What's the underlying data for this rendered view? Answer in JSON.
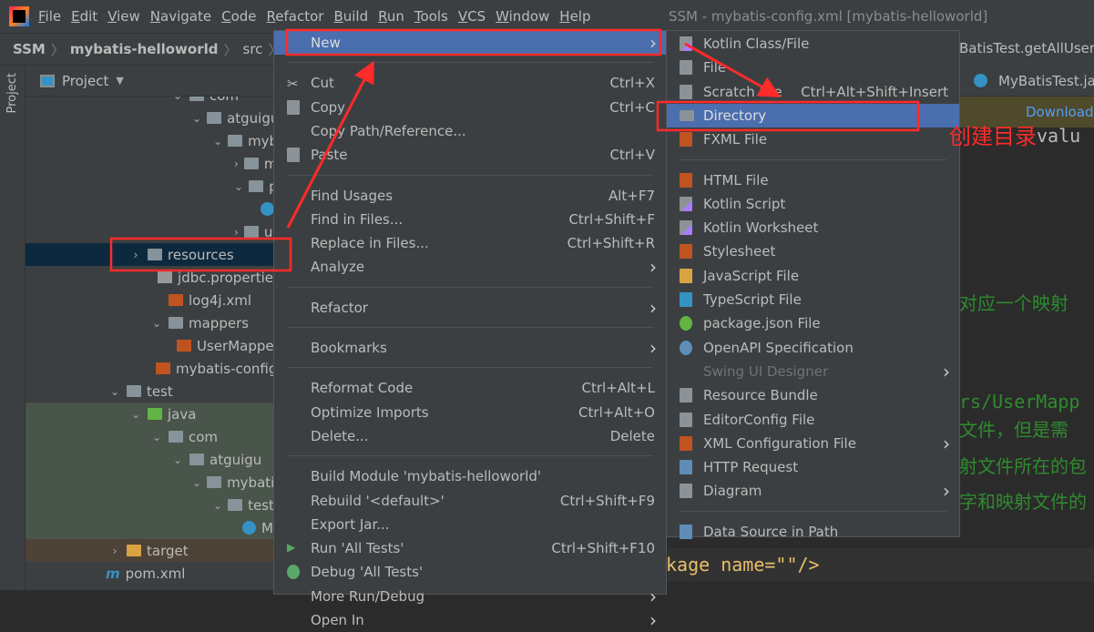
{
  "menubar": {
    "items": [
      "File",
      "Edit",
      "View",
      "Navigate",
      "Code",
      "Refactor",
      "Build",
      "Run",
      "Tools",
      "VCS",
      "Window",
      "Help"
    ],
    "window_title": "SSM - mybatis-config.xml [mybatis-helloworld]"
  },
  "breadcrumb": [
    "SSM",
    "mybatis-helloworld",
    "src",
    "ma"
  ],
  "tool_stripe": {
    "label": "Project"
  },
  "project_panel": {
    "title": "Project",
    "tree": [
      {
        "label": "com",
        "depth": 3,
        "icon": "folder",
        "expand": "open"
      },
      {
        "label": "atguigu",
        "depth": 4,
        "icon": "folder",
        "expand": "open"
      },
      {
        "label": "mybatis",
        "depth": 5,
        "icon": "folder",
        "expand": "open"
      },
      {
        "label": "mapp",
        "depth": 6,
        "icon": "folder",
        "expand": "closed"
      },
      {
        "label": "pojo",
        "depth": 6,
        "icon": "folder",
        "expand": "open"
      },
      {
        "label": "Us",
        "depth": 7,
        "icon": "class",
        "expand": ""
      },
      {
        "label": "utils",
        "depth": 6,
        "icon": "folder",
        "expand": "closed"
      },
      {
        "label": "resources",
        "depth": 1,
        "icon": "resources",
        "expand": "closed",
        "selected": true
      },
      {
        "label": "jdbc.propertie",
        "depth": 2,
        "icon": "properties",
        "expand": ""
      },
      {
        "label": "log4j.xml",
        "depth": 2,
        "icon": "xml",
        "expand": ""
      },
      {
        "label": "mappers",
        "depth": 2,
        "icon": "folder",
        "expand": "open"
      },
      {
        "label": "UserMappe",
        "depth": 3,
        "icon": "xml",
        "expand": ""
      },
      {
        "label": "mybatis-config",
        "depth": 2,
        "icon": "xml",
        "expand": ""
      },
      {
        "label": "test",
        "depth": 0,
        "icon": "folder",
        "expand": "open"
      },
      {
        "label": "java",
        "depth": 1,
        "icon": "testfolder",
        "expand": "open",
        "test": true
      },
      {
        "label": "com",
        "depth": 2,
        "icon": "folder",
        "expand": "open",
        "test": true
      },
      {
        "label": "atguigu",
        "depth": 3,
        "icon": "folder",
        "expand": "open",
        "test": true
      },
      {
        "label": "mybatis",
        "depth": 4,
        "icon": "folder",
        "expand": "open",
        "test": true
      },
      {
        "label": "test",
        "depth": 5,
        "icon": "folder",
        "expand": "open",
        "test": true
      },
      {
        "label": "M",
        "depth": 6,
        "icon": "class",
        "expand": "",
        "test": true
      },
      {
        "label": "target",
        "depth": 0,
        "icon": "target",
        "expand": "closed",
        "excluded": true
      },
      {
        "label": "pom.xml",
        "depth": -1,
        "icon": "maven",
        "expand": ""
      }
    ]
  },
  "context_menu": {
    "items": [
      {
        "label": "New",
        "submenu": true,
        "selected": true
      },
      {
        "sep": true
      },
      {
        "label": "Cut",
        "shortcut": "Ctrl+X",
        "icon": "scissors-icon"
      },
      {
        "label": "Copy",
        "shortcut": "Ctrl+C",
        "icon": "copy-icon"
      },
      {
        "label": "Copy Path/Reference..."
      },
      {
        "label": "Paste",
        "shortcut": "Ctrl+V",
        "icon": "paste-icon"
      },
      {
        "sep": true
      },
      {
        "label": "Find Usages",
        "shortcut": "Alt+F7"
      },
      {
        "label": "Find in Files...",
        "shortcut": "Ctrl+Shift+F"
      },
      {
        "label": "Replace in Files...",
        "shortcut": "Ctrl+Shift+R"
      },
      {
        "label": "Analyze",
        "submenu": true
      },
      {
        "sep": true
      },
      {
        "label": "Refactor",
        "submenu": true
      },
      {
        "sep": true
      },
      {
        "label": "Bookmarks",
        "submenu": true
      },
      {
        "sep": true
      },
      {
        "label": "Reformat Code",
        "shortcut": "Ctrl+Alt+L"
      },
      {
        "label": "Optimize Imports",
        "shortcut": "Ctrl+Alt+O"
      },
      {
        "label": "Delete...",
        "shortcut": "Delete"
      },
      {
        "sep": true
      },
      {
        "label": "Build Module 'mybatis-helloworld'"
      },
      {
        "label": "Rebuild '<default>'",
        "shortcut": "Ctrl+Shift+F9"
      },
      {
        "label": "Export Jar..."
      },
      {
        "label": "Run 'All Tests'",
        "shortcut": "Ctrl+Shift+F10",
        "icon": "run-icon"
      },
      {
        "label": "Debug 'All Tests'",
        "icon": "debug-icon"
      },
      {
        "label": "More Run/Debug",
        "submenu": true
      },
      {
        "label": "Open In",
        "submenu": true
      }
    ]
  },
  "new_submenu": {
    "items": [
      {
        "label": "Kotlin Class/File",
        "icon": "kotlin-class-icon"
      },
      {
        "label": "File",
        "icon": "file-icon"
      },
      {
        "label": "Scratch File",
        "shortcut": "Ctrl+Alt+Shift+Insert",
        "icon": "scratch-file-icon"
      },
      {
        "label": "Directory",
        "icon": "folder-icon",
        "selected": true
      },
      {
        "label": "FXML File",
        "icon": "fxml-icon"
      },
      {
        "sep": true
      },
      {
        "label": "HTML File",
        "icon": "html-icon"
      },
      {
        "label": "Kotlin Script",
        "icon": "kotlin-script-icon"
      },
      {
        "label": "Kotlin Worksheet",
        "icon": "kotlin-worksheet-icon"
      },
      {
        "label": "Stylesheet",
        "icon": "css-icon"
      },
      {
        "label": "JavaScript File",
        "icon": "js-icon"
      },
      {
        "label": "TypeScript File",
        "icon": "ts-icon"
      },
      {
        "label": "package.json File",
        "icon": "nodejs-icon"
      },
      {
        "label": "OpenAPI Specification",
        "icon": "openapi-icon"
      },
      {
        "label": "Swing UI Designer",
        "submenu": true,
        "disabled": true
      },
      {
        "label": "Resource Bundle",
        "icon": "resource-bundle-icon"
      },
      {
        "label": "EditorConfig File",
        "icon": "gear-icon"
      },
      {
        "label": "XML Configuration File",
        "submenu": true,
        "icon": "xml-icon"
      },
      {
        "label": "HTTP Request",
        "icon": "api-icon"
      },
      {
        "label": "Diagram",
        "submenu": true,
        "icon": "diagram-icon"
      },
      {
        "sep": true
      },
      {
        "label": "Data Source in Path",
        "icon": "database-icon"
      }
    ]
  },
  "editor": {
    "nav_crumb": "BatisTest.getAllUser",
    "tab": "MyBatisTest.jav",
    "banner_link": "Download",
    "lines": [
      {
        "text": "valu"
      },
      {
        "text": "对应一个映射"
      },
      {
        "text": "rs/UserMapp"
      },
      {
        "text": "文件，但是需"
      },
      {
        "text": "射文件所在的包"
      },
      {
        "text": "字和映射文件的"
      }
    ],
    "bottom_code": "kage name=\"\"/>"
  },
  "annotation": {
    "text": "创建目录",
    "color": "#ff2a2a"
  },
  "colors": {
    "selection": "#4b6eaf",
    "background": "#3c3f41",
    "annotation": "#ff2a2a",
    "comment_green": "#2f8b2f"
  }
}
